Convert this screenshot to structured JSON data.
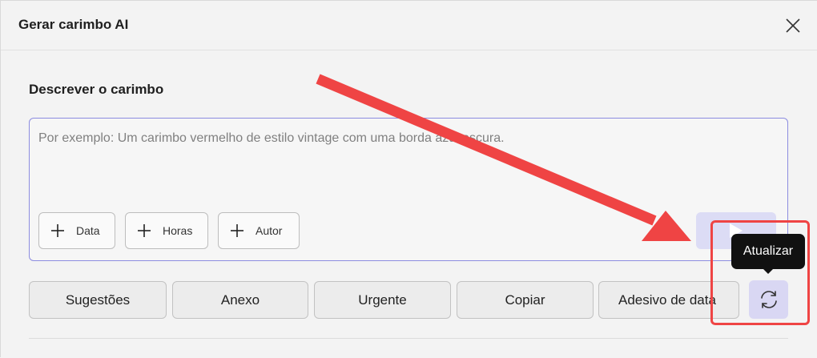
{
  "dialog": {
    "title": "Gerar carimbo AI",
    "close_icon": "close-icon"
  },
  "describe": {
    "label": "Descrever o carimbo",
    "placeholder": "Por exemplo: Um carimbo vermelho de estilo vintage com uma borda azul escura.",
    "value": ""
  },
  "chips": [
    {
      "label": "Data",
      "icon": "plus-icon"
    },
    {
      "label": "Horas",
      "icon": "plus-icon"
    },
    {
      "label": "Autor",
      "icon": "plus-icon"
    }
  ],
  "send_button": {
    "icon": "send-icon"
  },
  "suggestions": [
    {
      "label": "Sugestões"
    },
    {
      "label": "Anexo"
    },
    {
      "label": "Urgente"
    },
    {
      "label": "Copiar"
    },
    {
      "label": "Adesivo de data"
    }
  ],
  "refresh": {
    "icon": "refresh-icon",
    "tooltip": "Atualizar"
  },
  "colors": {
    "accent_border": "#8c8ce0",
    "refresh_bg": "#d9d7f3",
    "annotation_red": "#ef4444"
  }
}
